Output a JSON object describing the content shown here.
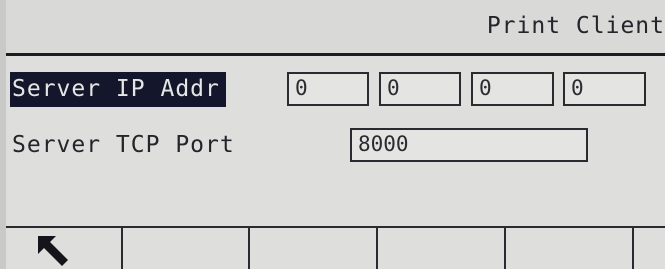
{
  "header": {
    "title": "Print Client"
  },
  "form": {
    "server_ip": {
      "label": "Server IP Addr",
      "octets": [
        "0",
        "0",
        "0",
        "0"
      ]
    },
    "server_port": {
      "label": "Server TCP Port",
      "value": "8000"
    }
  },
  "softkeys": {
    "back_icon": "exit-arrow-icon",
    "count": 6
  },
  "colors": {
    "background": "#dedfdd",
    "selection": "#14172b",
    "text": "#24242a"
  }
}
